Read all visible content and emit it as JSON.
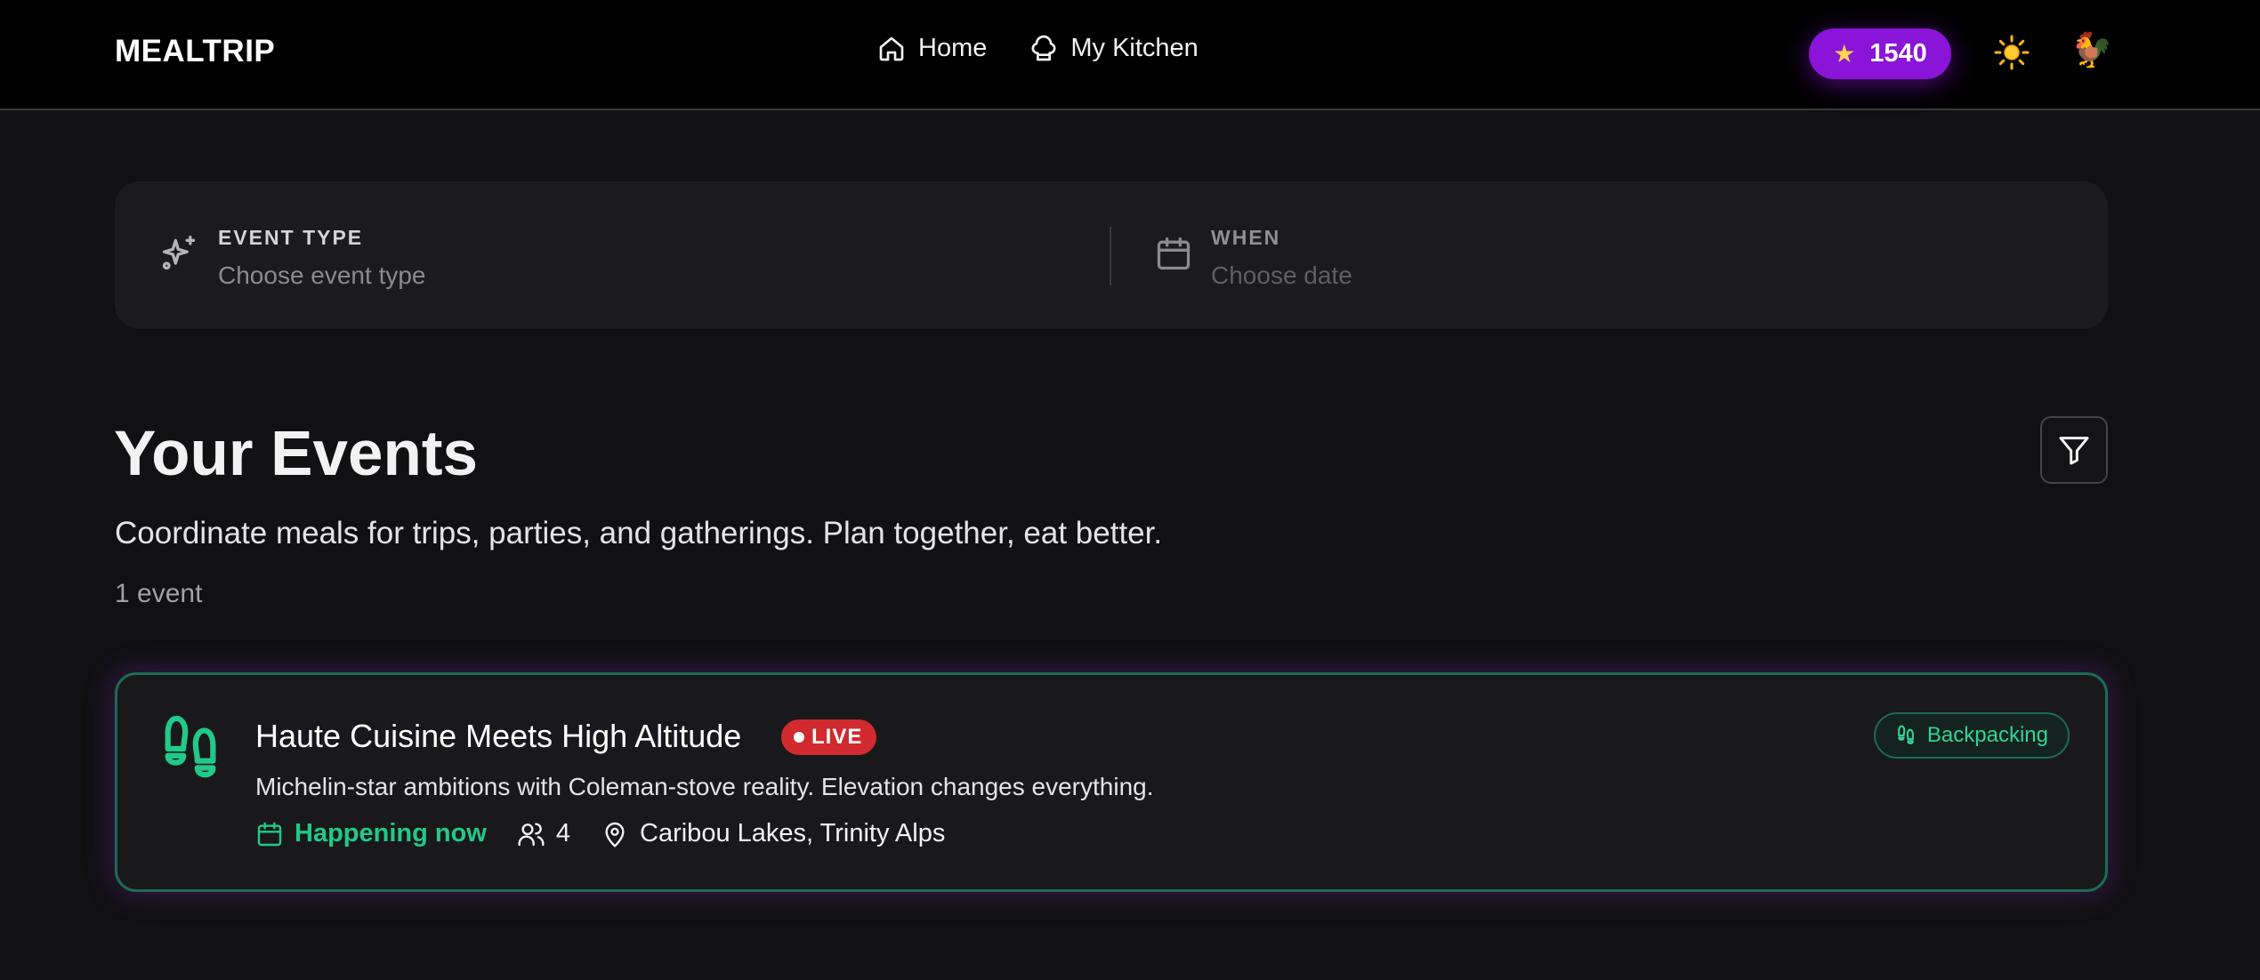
{
  "header": {
    "brand": "MEALTRIP",
    "nav": [
      {
        "label": "Home",
        "icon": "home-icon"
      },
      {
        "label": "My Kitchen",
        "icon": "chef-hat-icon"
      }
    ],
    "points": {
      "icon": "star-icon",
      "value": "1540"
    },
    "theme_toggle": {
      "icon": "sun-icon",
      "glyph": "☀️"
    },
    "avatar": {
      "glyph": "🐓"
    }
  },
  "search": {
    "event_type": {
      "label": "EVENT TYPE",
      "placeholder": "Choose event type",
      "icon": "sparkles-icon"
    },
    "when": {
      "label": "WHEN",
      "placeholder": "Choose date",
      "icon": "calendar-icon"
    }
  },
  "main": {
    "title": "Your Events",
    "subtitle": "Coordinate meals for trips, parties, and gatherings. Plan together, eat better.",
    "count": "1 event",
    "filter_icon": "filter-icon"
  },
  "events": [
    {
      "title": "Haute Cuisine Meets High Altitude",
      "status_badge": "LIVE",
      "description": "Michelin-star ambitions with Coleman-stove reality. Elevation changes everything.",
      "time": "Happening now",
      "attendees": "4",
      "location": "Caribou Lakes, Trinity Alps",
      "category": "Backpacking",
      "icon": "footprints-icon"
    }
  ],
  "colors": {
    "background": "#111113",
    "header": "#000000",
    "accent_purple": "#8a14d8",
    "live_red": "#d12a2f",
    "green": "#22c98a",
    "card_border": "#1c6b55"
  }
}
